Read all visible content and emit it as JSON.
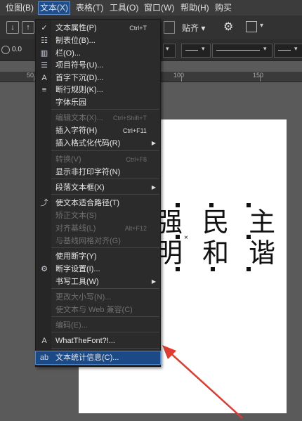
{
  "menubar": {
    "items": [
      {
        "label": "位图(B)"
      },
      {
        "label": "文本(X)"
      },
      {
        "label": "表格(T)"
      },
      {
        "label": "工具(O)"
      },
      {
        "label": "窗口(W)"
      },
      {
        "label": "帮助(H)"
      },
      {
        "label": "购买"
      }
    ],
    "active_index": 1
  },
  "toolbar": {
    "snap_label": "贴齐",
    "outline_value": "0.0"
  },
  "ruler": {
    "labels": [
      "50",
      "100",
      "150"
    ]
  },
  "canvas": {
    "line1": "强 民 主",
    "line2": "明 和 谐"
  },
  "text_menu": {
    "items": [
      {
        "label": "文本属性(P)",
        "shortcut": "Ctrl+T",
        "icon": "check-icon",
        "enabled": true,
        "submenu": false
      },
      {
        "label": "制表位(B)...",
        "shortcut": "",
        "icon": "tab-stops-icon",
        "enabled": true,
        "submenu": false
      },
      {
        "label": "栏(O)...",
        "shortcut": "",
        "icon": "columns-icon",
        "enabled": true,
        "submenu": false
      },
      {
        "label": "项目符号(U)...",
        "shortcut": "",
        "icon": "bullets-icon",
        "enabled": true,
        "submenu": false
      },
      {
        "label": "首字下沉(D)...",
        "shortcut": "",
        "icon": "drop-cap-icon",
        "enabled": true,
        "submenu": false
      },
      {
        "label": "断行规则(K)...",
        "shortcut": "",
        "icon": "line-break-icon",
        "enabled": true,
        "submenu": false
      },
      {
        "label": "字体乐园",
        "shortcut": "",
        "icon": "",
        "enabled": true,
        "submenu": false
      },
      {
        "label": "编辑文本(X)...",
        "shortcut": "Ctrl+Shift+T",
        "icon": "",
        "enabled": false,
        "submenu": false
      },
      {
        "label": "插入字符(H)",
        "shortcut": "Ctrl+F11",
        "icon": "",
        "enabled": true,
        "submenu": false
      },
      {
        "label": "插入格式化代码(R)",
        "shortcut": "",
        "icon": "",
        "enabled": true,
        "submenu": true
      },
      {
        "label": "转换(V)",
        "shortcut": "Ctrl+F8",
        "icon": "",
        "enabled": false,
        "submenu": false
      },
      {
        "label": "显示非打印字符(N)",
        "shortcut": "",
        "icon": "",
        "enabled": true,
        "submenu": false
      },
      {
        "label": "段落文本框(X)",
        "shortcut": "",
        "icon": "",
        "enabled": true,
        "submenu": true
      },
      {
        "label": "使文本适合路径(T)",
        "shortcut": "",
        "icon": "fit-path-icon",
        "enabled": true,
        "submenu": false
      },
      {
        "label": "矫正文本(S)",
        "shortcut": "",
        "icon": "",
        "enabled": false,
        "submenu": false
      },
      {
        "label": "对齐基线(L)",
        "shortcut": "Alt+F12",
        "icon": "",
        "enabled": false,
        "submenu": false
      },
      {
        "label": "与基线网格对齐(G)",
        "shortcut": "",
        "icon": "",
        "enabled": false,
        "submenu": false
      },
      {
        "label": "使用断字(Y)",
        "shortcut": "",
        "icon": "",
        "enabled": true,
        "submenu": false
      },
      {
        "label": "断字设置(I)...",
        "shortcut": "",
        "icon": "hyphen-settings-icon",
        "enabled": true,
        "submenu": false
      },
      {
        "label": "书写工具(W)",
        "shortcut": "",
        "icon": "",
        "enabled": true,
        "submenu": true
      },
      {
        "label": "更改大小写(N)...",
        "shortcut": "",
        "icon": "",
        "enabled": false,
        "submenu": false
      },
      {
        "label": "使文本与 Web 兼容(C)",
        "shortcut": "",
        "icon": "",
        "enabled": false,
        "submenu": false
      },
      {
        "label": "编码(E)...",
        "shortcut": "",
        "icon": "",
        "enabled": false,
        "submenu": false
      },
      {
        "label": "WhatTheFont?!...",
        "shortcut": "",
        "icon": "whatthefont-icon",
        "enabled": true,
        "submenu": false
      },
      {
        "label": "文本统计信息(C)...",
        "shortcut": "",
        "icon": "statistics-icon",
        "enabled": true,
        "submenu": false
      }
    ],
    "selected_index": 24
  },
  "annotation": {
    "arrow_color": "#e0392f"
  }
}
